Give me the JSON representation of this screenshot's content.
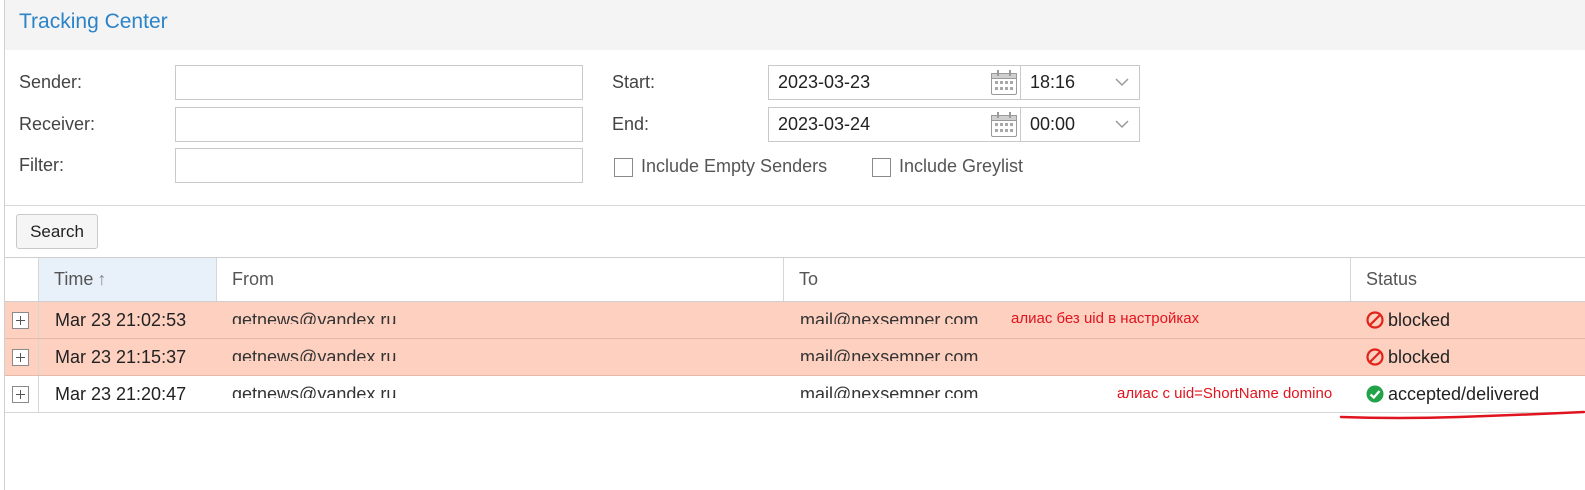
{
  "header": {
    "title": "Tracking Center"
  },
  "form": {
    "sender_label": "Sender:",
    "receiver_label": "Receiver:",
    "filter_label": "Filter:",
    "sender_value": "",
    "receiver_value": "",
    "filter_value": "",
    "start_label": "Start:",
    "end_label": "End:",
    "start_date": "2023-03-23",
    "start_time": "18:16",
    "end_date": "2023-03-24",
    "end_time": "00:00",
    "include_empty_senders_label": "Include Empty Senders",
    "include_greylist_label": "Include Greylist",
    "include_empty_senders_checked": false,
    "include_greylist_checked": false
  },
  "toolbar": {
    "search_label": "Search"
  },
  "grid": {
    "columns": [
      "Time",
      "From",
      "To",
      "Status"
    ],
    "sort": {
      "column": "Time",
      "direction": "ascending"
    },
    "rows": [
      {
        "time": "Mar 23 21:02:53",
        "from": "getnews@yandex.ru",
        "to": "mail@nexsemper.com",
        "status": "blocked",
        "status_kind": "blocked"
      },
      {
        "time": "Mar 23 21:15:37",
        "from": "getnews@yandex.ru",
        "to": "mail@nexsemper.com",
        "status": "blocked",
        "status_kind": "blocked"
      },
      {
        "time": "Mar 23 21:20:47",
        "from": "getnews@yandex.ru",
        "to": "mail@nexsemper.com",
        "status": "accepted/delivered",
        "status_kind": "delivered"
      }
    ]
  },
  "annotations": {
    "row1_note": "алиас без uid в настройках",
    "row3_note": "алиас с uid=ShortName domino"
  },
  "colors": {
    "title": "#2b83c8",
    "blocked_row": "#fdd0c0",
    "blocked_icon": "#e2231a",
    "delivered_icon": "#21a34a",
    "annotation": "#e0141e"
  }
}
